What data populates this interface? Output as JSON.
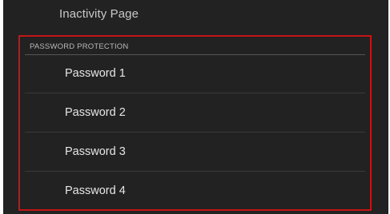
{
  "settings": {
    "previous_item": "Inactivity Page",
    "section_header": "PASSWORD PROTECTION",
    "items": [
      {
        "label": "Password 1"
      },
      {
        "label": "Password 2"
      },
      {
        "label": "Password 3"
      },
      {
        "label": "Password 4"
      }
    ]
  },
  "colors": {
    "background": "#222222",
    "highlight_border": "#c41515",
    "text": "#e6e6e6",
    "section_header_text": "#b8b8b8"
  }
}
